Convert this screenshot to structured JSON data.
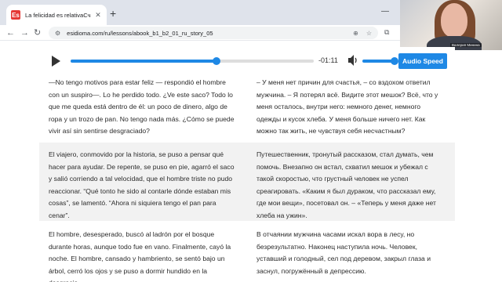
{
  "browser": {
    "tab_title": "La felicidad es relativaСчастье",
    "favicon_letter": "Es",
    "url": "esidioma.com/ru/lessons/abook_b1_b2_01_ru_story_05"
  },
  "webcam": {
    "name": "Валерия Минина"
  },
  "player": {
    "time": "-01:11",
    "progress": 0.6,
    "volume": 0.9,
    "speed_label": "Audio Speed"
  },
  "story": {
    "paragraphs": [
      {
        "es": "—No tengo motivos para estar feliz — respondió el hombre con un suspiro—. Lo he perdido todo. ¿Ve este saco? Todo lo que me queda está dentro de él: un poco de dinero, algo de ropa y un trozo de pan. No tengo nada más. ¿Cómo se puede vivir así sin sentirse desgraciado?",
        "ru": "– У меня нет причин для счастья, – со вздохом ответил мужчина. – Я потерял всё. Видите этот мешок? Всё, что у меня осталось, внутри него: немного денег, немного одежды и кусок хлеба. У меня больше ничего нет. Как можно так жить, не чувствуя себя несчастным?"
      },
      {
        "es": "El viajero, conmovido por la historia, se puso a pensar qué hacer para ayudar. De repente, se puso en pie, agarró el saco y salió corriendo a tal velocidad, que el hombre triste no pudo reaccionar. “Qué tonto he sido al contarle dónde estaban mis cosas”, se lamentó. “Ahora ni siquiera tengo el pan para cenar”.",
        "ru": "Путешественник, тронутый рассказом, стал думать, чем помочь. Внезапно он встал, схватил мешок и убежал с такой скоростью, что грустный человек не успел среагировать. «Каким я был дураком, что рассказал ему, где мои вещи», посетовал он. – «Теперь у меня даже нет хлеба на ужин»."
      },
      {
        "es": "El hombre, desesperado, buscó al ladrón por el bosque durante horas, aunque todo fue en vano. Finalmente, cayó la noche. El hombre, cansado y hambriento, se sentó bajo un árbol, cerró los ojos y se puso a dormir hundido en la desgracia.",
        "ru": "В отчаянии мужчина часами искал вора в лесу, но безрезультатно. Наконец наступила ночь. Человек, уставший и голодный, сел под деревом, закрыл глаза и заснул, погружённый в депрессию."
      }
    ]
  },
  "colors": {
    "accent": "#1e88e5",
    "alt_row": "#f2f2f2"
  }
}
